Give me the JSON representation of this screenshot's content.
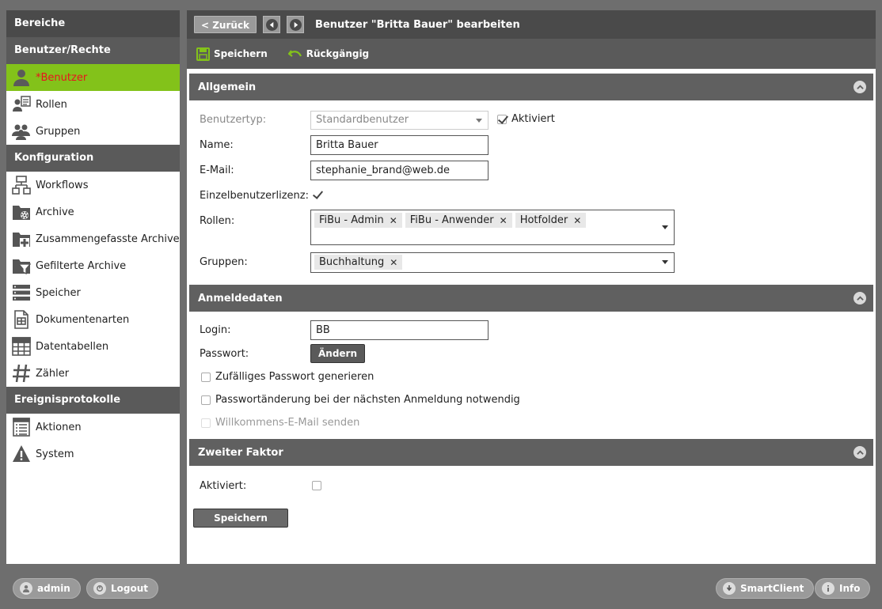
{
  "sidebar": {
    "title": "Bereiche",
    "sections": [
      {
        "heading": "Benutzer/Rechte",
        "items": [
          {
            "label": "*Benutzer",
            "icon": "user-icon",
            "active": true
          },
          {
            "label": "Rollen",
            "icon": "roles-icon"
          },
          {
            "label": "Gruppen",
            "icon": "group-icon"
          }
        ]
      },
      {
        "heading": "Konfiguration",
        "items": [
          {
            "label": "Workflows",
            "icon": "workflow-icon"
          },
          {
            "label": "Archive",
            "icon": "archive-icon"
          },
          {
            "label": "Zusammengefasste Archive",
            "icon": "combined-archive-icon"
          },
          {
            "label": "Gefilterte Archive",
            "icon": "filtered-archive-icon"
          },
          {
            "label": "Speicher",
            "icon": "storage-icon"
          },
          {
            "label": "Dokumentenarten",
            "icon": "document-types-icon"
          },
          {
            "label": "Datentabellen",
            "icon": "data-table-icon"
          },
          {
            "label": "Zähler",
            "icon": "counter-icon"
          }
        ]
      },
      {
        "heading": "Ereignisprotokolle",
        "items": [
          {
            "label": "Aktionen",
            "icon": "actions-log-icon"
          },
          {
            "label": "System",
            "icon": "warning-icon"
          }
        ]
      }
    ]
  },
  "topbar": {
    "back_label": "< Zurück",
    "title": "Benutzer \"Britta Bauer\" bearbeiten"
  },
  "toolbar": {
    "save_label": "Speichern",
    "undo_label": "Rückgängig"
  },
  "general": {
    "heading": "Allgemein",
    "usertype_label": "Benutzertyp:",
    "usertype_value": "Standardbenutzer",
    "activated_label": "Aktiviert",
    "activated_checked": true,
    "name_label": "Name:",
    "name_value": "Britta Bauer",
    "email_label": "E-Mail:",
    "email_value": "stephanie_brand@web.de",
    "single_license_label": "Einzelbenutzerlizenz:",
    "single_license_checked": true,
    "roles_label": "Rollen:",
    "roles": [
      "FiBu - Admin",
      "FiBu - Anwender",
      "Hotfolder"
    ],
    "groups_label": "Gruppen:",
    "groups": [
      "Buchhaltung"
    ]
  },
  "login": {
    "heading": "Anmeldedaten",
    "login_label": "Login:",
    "login_value": "BB",
    "password_label": "Passwort:",
    "change_label": "Ändern",
    "random_password_label": "Zufälliges Passwort generieren",
    "change_next_login_label": "Passwortänderung bei der nächsten Anmeldung notwendig",
    "welcome_mail_label": "Willkommens-E-Mail senden"
  },
  "second_factor": {
    "heading": "Zweiter Faktor",
    "activated_label": "Aktiviert:"
  },
  "footer": {
    "save_label": "Speichern",
    "user_label": "admin",
    "logout_label": "Logout",
    "smartclient_label": "SmartClient",
    "info_label": "Info"
  },
  "colors": {
    "active_item_bg": "#83c21a",
    "active_item_text": "#e8141e",
    "header_dark": "#4a4a4a",
    "toolbar_icon": "#83c21a"
  }
}
